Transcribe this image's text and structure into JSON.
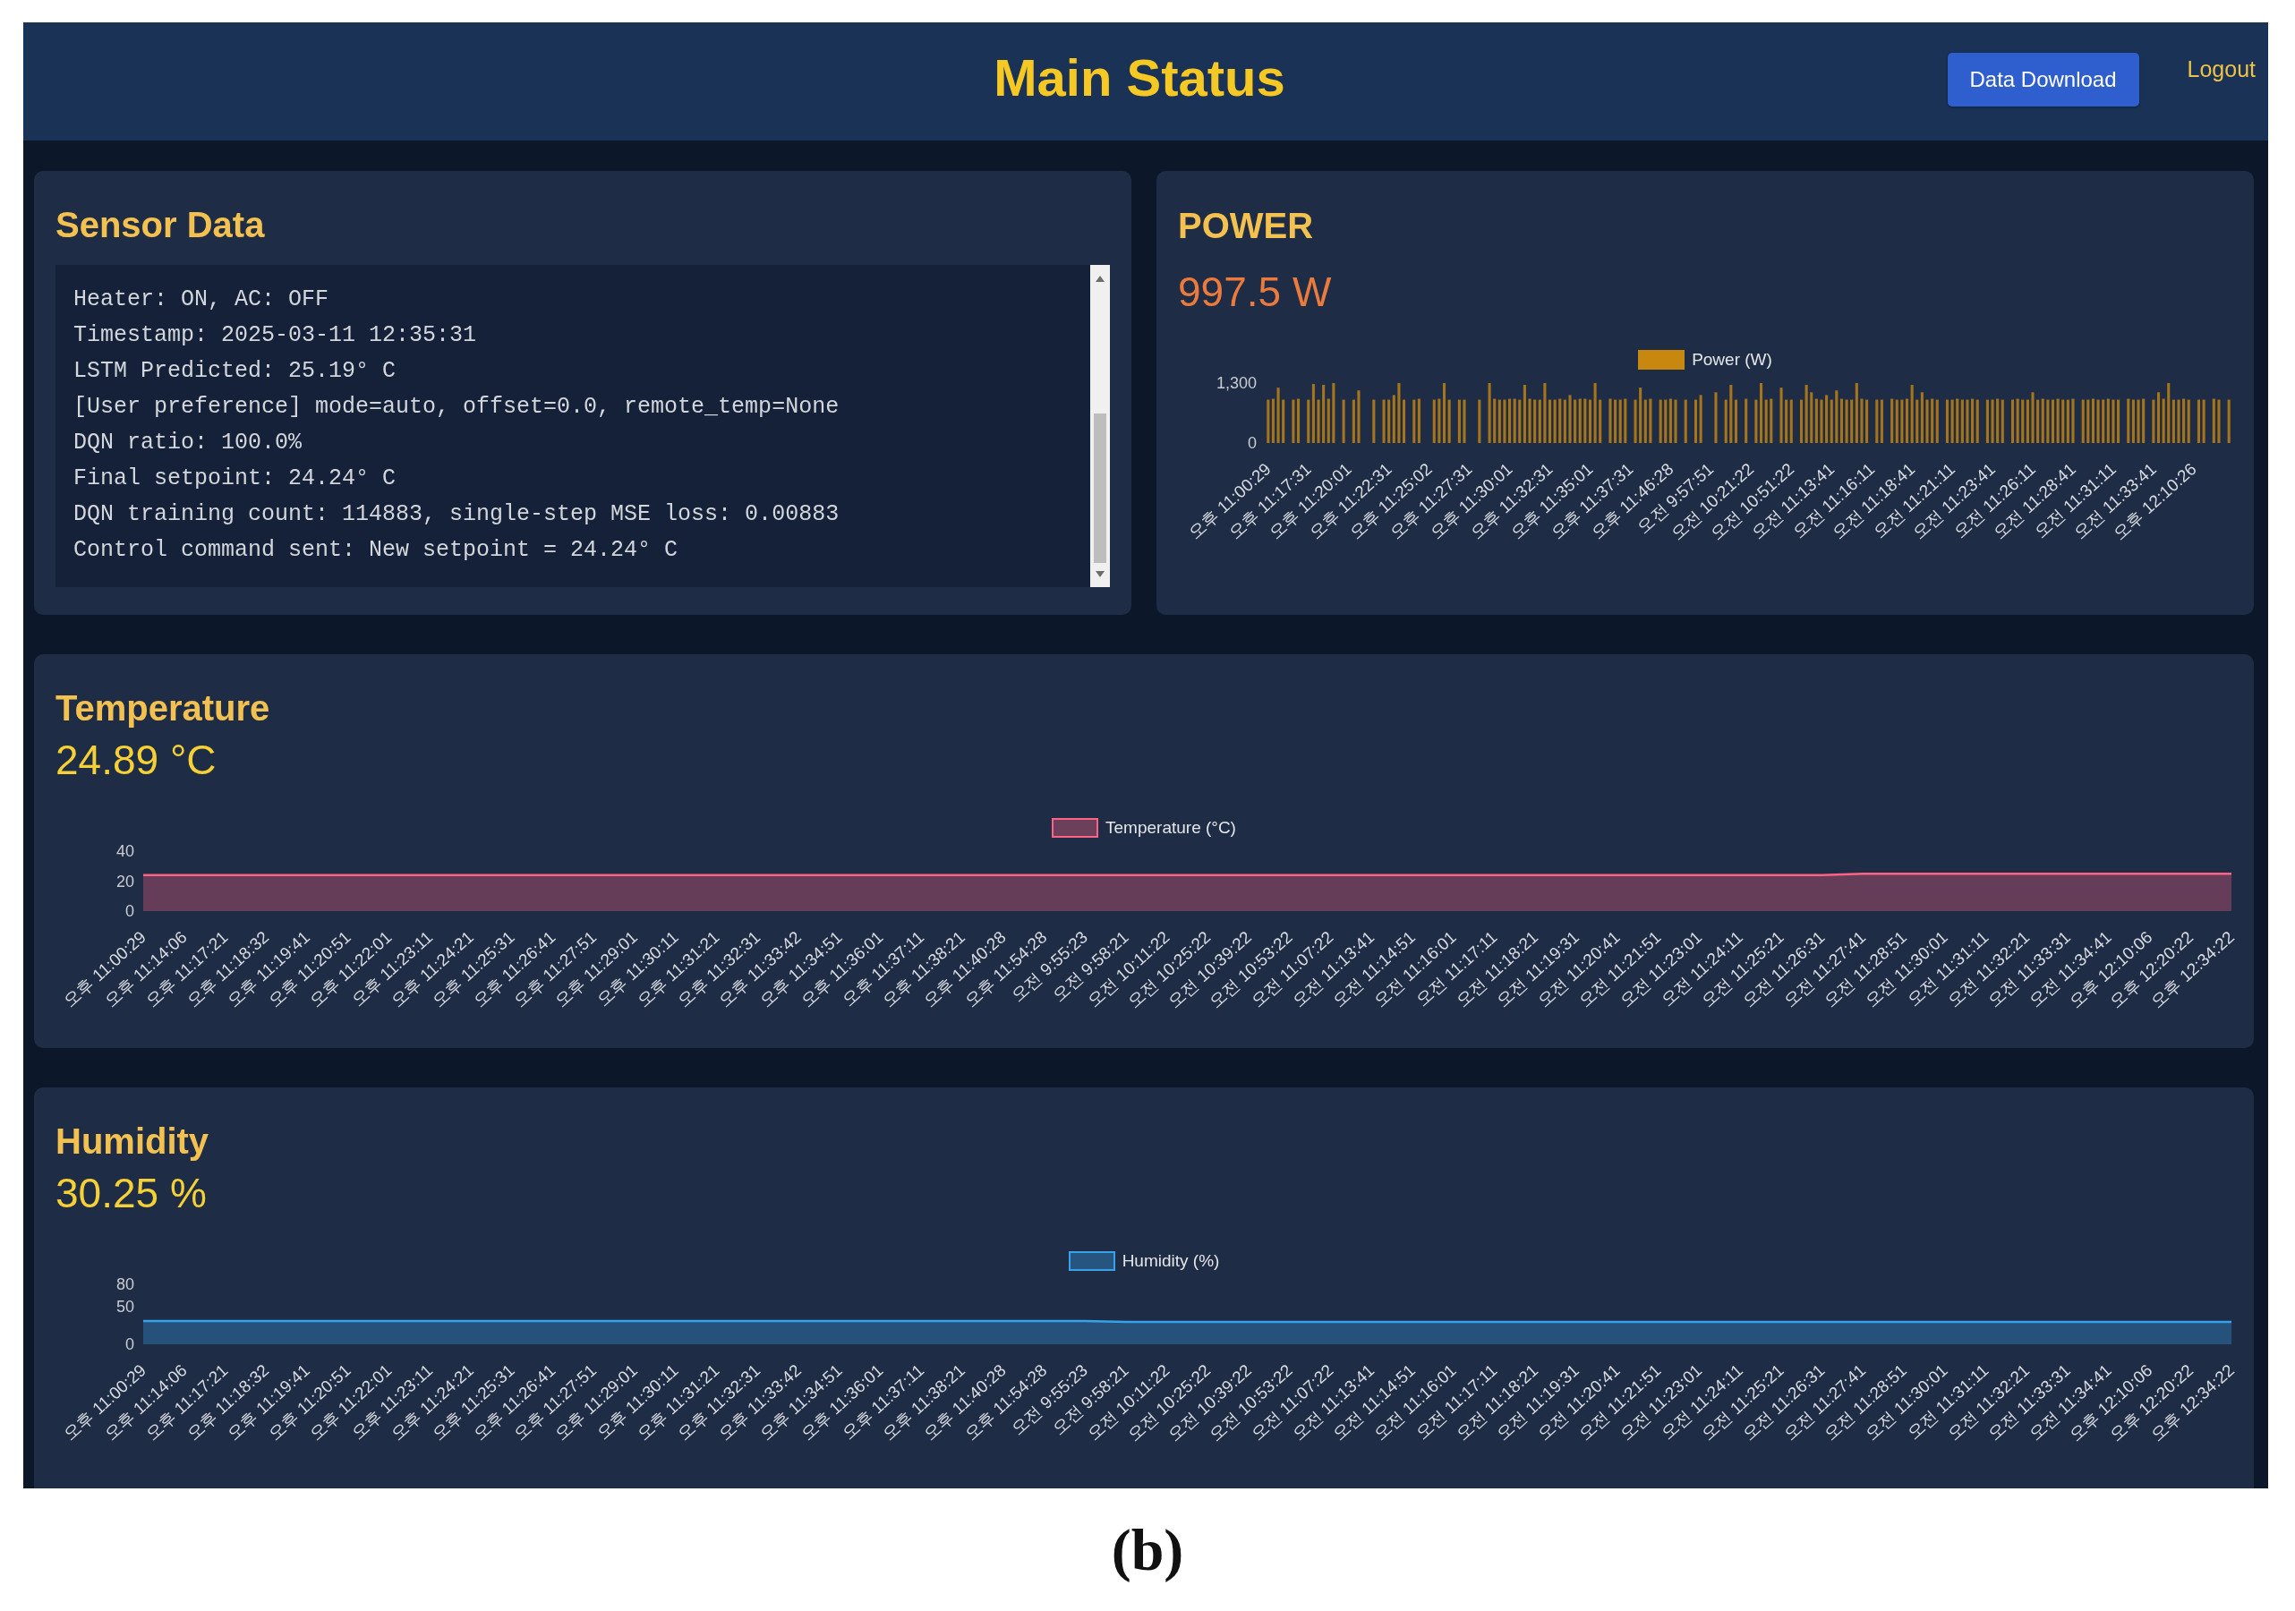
{
  "header": {
    "title": "Main Status",
    "download_button": "Data Download",
    "logout_link": "Logout"
  },
  "sensor_data": {
    "title": "Sensor Data",
    "log_lines": [
      "Heater: ON, AC: OFF",
      "Timestamp: 2025-03-11 12:35:31",
      "LSTM Predicted: 25.19° C",
      "[User preference] mode=auto, offset=0.0, remote_temp=None",
      "DQN ratio: 100.0%",
      "Final setpoint: 24.24° C",
      "DQN training count: 114883, single-step MSE loss: 0.00883",
      "Control command sent: New setpoint = 24.24° C"
    ]
  },
  "power": {
    "title": "POWER",
    "reading": "997.5 W",
    "chart_data": {
      "type": "bar",
      "ylim": [
        0,
        1300
      ],
      "yticks": [
        {
          "value": 0,
          "label": "0"
        },
        {
          "value": 1300,
          "label": "1,300"
        }
      ],
      "categories": [
        "오후 11:00:29",
        null,
        null,
        null,
        null,
        null,
        null,
        null,
        "오후 11:17:31",
        null,
        null,
        null,
        null,
        null,
        null,
        null,
        "오후 11:20:01",
        null,
        null,
        null,
        null,
        null,
        null,
        null,
        "오후 11:22:31",
        null,
        null,
        null,
        null,
        null,
        null,
        null,
        "오후 11:25:02",
        null,
        null,
        null,
        null,
        null,
        null,
        null,
        "오후 11:27:31",
        null,
        null,
        null,
        null,
        null,
        null,
        null,
        "오후 11:30:01",
        null,
        null,
        null,
        null,
        null,
        null,
        null,
        "오후 11:32:31",
        null,
        null,
        null,
        null,
        null,
        null,
        null,
        "오후 11:35:01",
        null,
        null,
        null,
        null,
        null,
        null,
        null,
        "오후 11:37:31",
        null,
        null,
        null,
        null,
        null,
        null,
        null,
        "오후 11:46:28",
        null,
        null,
        null,
        null,
        null,
        null,
        null,
        "오전 9:57:51",
        null,
        null,
        null,
        null,
        null,
        null,
        null,
        "오전 10:21:22",
        null,
        null,
        null,
        null,
        null,
        null,
        null,
        "오전 10:51:22",
        null,
        null,
        null,
        null,
        null,
        null,
        null,
        "오전 11:13:41",
        null,
        null,
        null,
        null,
        null,
        null,
        null,
        "오전 11:16:11",
        null,
        null,
        null,
        null,
        null,
        null,
        null,
        "오전 11:18:41",
        null,
        null,
        null,
        null,
        null,
        null,
        null,
        "오전 11:21:11",
        null,
        null,
        null,
        null,
        null,
        null,
        null,
        "오전 11:23:41",
        null,
        null,
        null,
        null,
        null,
        null,
        null,
        "오전 11:26:11",
        null,
        null,
        null,
        null,
        null,
        null,
        null,
        "오전 11:28:41",
        null,
        null,
        null,
        null,
        null,
        null,
        null,
        "오전 11:31:11",
        null,
        null,
        null,
        null,
        null,
        null,
        null,
        "오전 11:33:41",
        null,
        null,
        null,
        null,
        null,
        null,
        null,
        "오후 12:10:26",
        null,
        null,
        null,
        null,
        null,
        null,
        null
      ],
      "series": [
        {
          "name": "Power (W)",
          "color": "#c8870f",
          "values": [
            940,
            960,
            1200,
            940,
            0,
            940,
            960,
            0,
            940,
            1280,
            940,
            1260,
            960,
            1300,
            0,
            940,
            0,
            940,
            1140,
            0,
            0,
            940,
            0,
            940,
            940,
            1040,
            1300,
            940,
            0,
            940,
            960,
            0,
            0,
            940,
            960,
            1300,
            940,
            0,
            940,
            940,
            0,
            0,
            940,
            0,
            1300,
            960,
            940,
            940,
            960,
            960,
            940,
            1260,
            960,
            940,
            940,
            1300,
            940,
            940,
            960,
            940,
            1040,
            940,
            960,
            960,
            940,
            1300,
            940,
            0,
            960,
            940,
            940,
            960,
            0,
            940,
            1200,
            940,
            960,
            0,
            940,
            940,
            960,
            940,
            0,
            940,
            0,
            940,
            1040,
            0,
            0,
            1100,
            0,
            940,
            1260,
            940,
            0,
            960,
            0,
            940,
            1300,
            940,
            960,
            0,
            1200,
            940,
            940,
            0,
            940,
            1260,
            1100,
            960,
            940,
            1040,
            940,
            1140,
            960,
            940,
            940,
            1300,
            960,
            940,
            0,
            940,
            940,
            0,
            960,
            940,
            940,
            960,
            1260,
            940,
            1100,
            940,
            960,
            940,
            0,
            940,
            940,
            960,
            940,
            940,
            960,
            940,
            0,
            940,
            940,
            960,
            940,
            0,
            940,
            960,
            940,
            940,
            1100,
            940,
            960,
            940,
            940,
            960,
            940,
            940,
            960,
            0,
            940,
            940,
            960,
            940,
            940,
            960,
            940,
            940,
            0,
            960,
            940,
            940,
            960,
            0,
            940,
            1100,
            960,
            1300,
            940,
            940,
            960,
            940,
            0,
            940,
            940,
            0,
            960,
            940,
            0,
            940
          ]
        }
      ]
    }
  },
  "temperature": {
    "title": "Temperature",
    "reading": "24.89 °C",
    "chart_data": {
      "type": "area",
      "ylim": [
        0,
        40
      ],
      "yticks": [
        0,
        20,
        40
      ],
      "categories": [
        "오후 11:00:29",
        "오후 11:14:06",
        "오후 11:17:21",
        "오후 11:18:32",
        "오후 11:19:41",
        "오후 11:20:51",
        "오후 11:22:01",
        "오후 11:23:11",
        "오후 11:24:21",
        "오후 11:25:31",
        "오후 11:26:41",
        "오후 11:27:51",
        "오후 11:29:01",
        "오후 11:30:11",
        "오후 11:31:21",
        "오후 11:32:31",
        "오후 11:33:42",
        "오후 11:34:51",
        "오후 11:36:01",
        "오후 11:37:11",
        "오후 11:38:21",
        "오후 11:40:28",
        "오후 11:54:28",
        "오전 9:55:23",
        "오전 9:58:21",
        "오전 10:11:22",
        "오전 10:25:22",
        "오전 10:39:22",
        "오전 10:53:22",
        "오전 11:07:22",
        "오전 11:13:41",
        "오전 11:14:51",
        "오전 11:16:01",
        "오전 11:17:11",
        "오전 11:18:21",
        "오전 11:19:31",
        "오전 11:20:41",
        "오전 11:21:51",
        "오전 11:23:01",
        "오전 11:24:11",
        "오전 11:25:21",
        "오전 11:26:31",
        "오전 11:27:41",
        "오전 11:28:51",
        "오전 11:30:01",
        "오전 11:31:11",
        "오전 11:32:21",
        "오전 11:33:31",
        "오전 11:34:41",
        "오후 12:10:06",
        "오후 12:20:22",
        "오후 12:34:22"
      ],
      "series": [
        {
          "name": "Temperature (°C)",
          "color": "#ff6384",
          "values": [
            24,
            24,
            24,
            24,
            24,
            24,
            24,
            24,
            24,
            24,
            24,
            24,
            24,
            24,
            24,
            24,
            24,
            24,
            24,
            24,
            24,
            24,
            24,
            24,
            24,
            24,
            24,
            24,
            24,
            24,
            24,
            24,
            24,
            24,
            24,
            24,
            24,
            24,
            24,
            24,
            24,
            24,
            25,
            25,
            25,
            25,
            25,
            25,
            25,
            25,
            25,
            25
          ]
        }
      ]
    }
  },
  "humidity": {
    "title": "Humidity",
    "reading": "30.25 %",
    "chart_data": {
      "type": "area",
      "ylim": [
        0,
        80
      ],
      "yticks": [
        0,
        50,
        80
      ],
      "categories": [
        "오후 11:00:29",
        "오후 11:14:06",
        "오후 11:17:21",
        "오후 11:18:32",
        "오후 11:19:41",
        "오후 11:20:51",
        "오후 11:22:01",
        "오후 11:23:11",
        "오후 11:24:21",
        "오후 11:25:31",
        "오후 11:26:41",
        "오후 11:27:51",
        "오후 11:29:01",
        "오후 11:30:11",
        "오후 11:31:21",
        "오후 11:32:31",
        "오후 11:33:42",
        "오후 11:34:51",
        "오후 11:36:01",
        "오후 11:37:11",
        "오후 11:38:21",
        "오후 11:40:28",
        "오후 11:54:28",
        "오전 9:55:23",
        "오전 9:58:21",
        "오전 10:11:22",
        "오전 10:25:22",
        "오전 10:39:22",
        "오전 10:53:22",
        "오전 11:07:22",
        "오전 11:13:41",
        "오전 11:14:51",
        "오전 11:16:01",
        "오전 11:17:11",
        "오전 11:18:21",
        "오전 11:19:31",
        "오전 11:20:41",
        "오전 11:21:51",
        "오전 11:23:01",
        "오전 11:24:11",
        "오전 11:25:21",
        "오전 11:26:31",
        "오전 11:27:41",
        "오전 11:28:51",
        "오전 11:30:01",
        "오전 11:31:11",
        "오전 11:32:21",
        "오전 11:33:31",
        "오전 11:34:41",
        "오후 12:10:06",
        "오후 12:20:22",
        "오후 12:34:22"
      ],
      "series": [
        {
          "name": "Humidity (%)",
          "color": "#36a2eb",
          "values": [
            31,
            31,
            31,
            31,
            31,
            31,
            31,
            31,
            31,
            31,
            31,
            31,
            31,
            31,
            31,
            31,
            31,
            31,
            31,
            31,
            31,
            31,
            31,
            31,
            30,
            30,
            30,
            30,
            30,
            30,
            30,
            30,
            30,
            30,
            30,
            30,
            30,
            30,
            30,
            30,
            30,
            30,
            30,
            30,
            30,
            30,
            30,
            30,
            30,
            30,
            30,
            30
          ]
        }
      ]
    }
  },
  "caption": "(b)"
}
